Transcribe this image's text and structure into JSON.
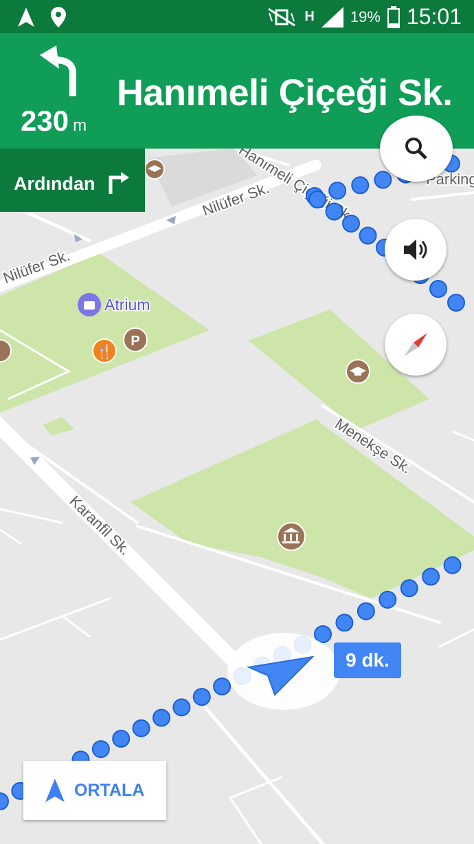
{
  "status_bar": {
    "network": "H",
    "battery": "19%",
    "time": "15:01"
  },
  "nav": {
    "distance": "230",
    "distance_unit": "m",
    "street": "Hanımeli Çiçeği Sk.",
    "then_label": "Ardından"
  },
  "map": {
    "streets": [
      "Hanımeli Çiçeği Sk.",
      "Nilüfer Sk.",
      "Nilüfer Sk.",
      "Menekşe Sk.",
      "Karanfil Sk."
    ],
    "places": [
      "Atrium",
      "Parking"
    ]
  },
  "eta": "9 dk.",
  "recenter_label": "ORTALA",
  "colors": {
    "header_green": "#0f9d58",
    "dark_green": "#0b7a3c",
    "route_blue": "#4285f4",
    "park_green": "#cde5a9"
  },
  "icons": [
    "search-icon",
    "volume-icon",
    "compass-icon",
    "navigation-arrow-icon"
  ]
}
